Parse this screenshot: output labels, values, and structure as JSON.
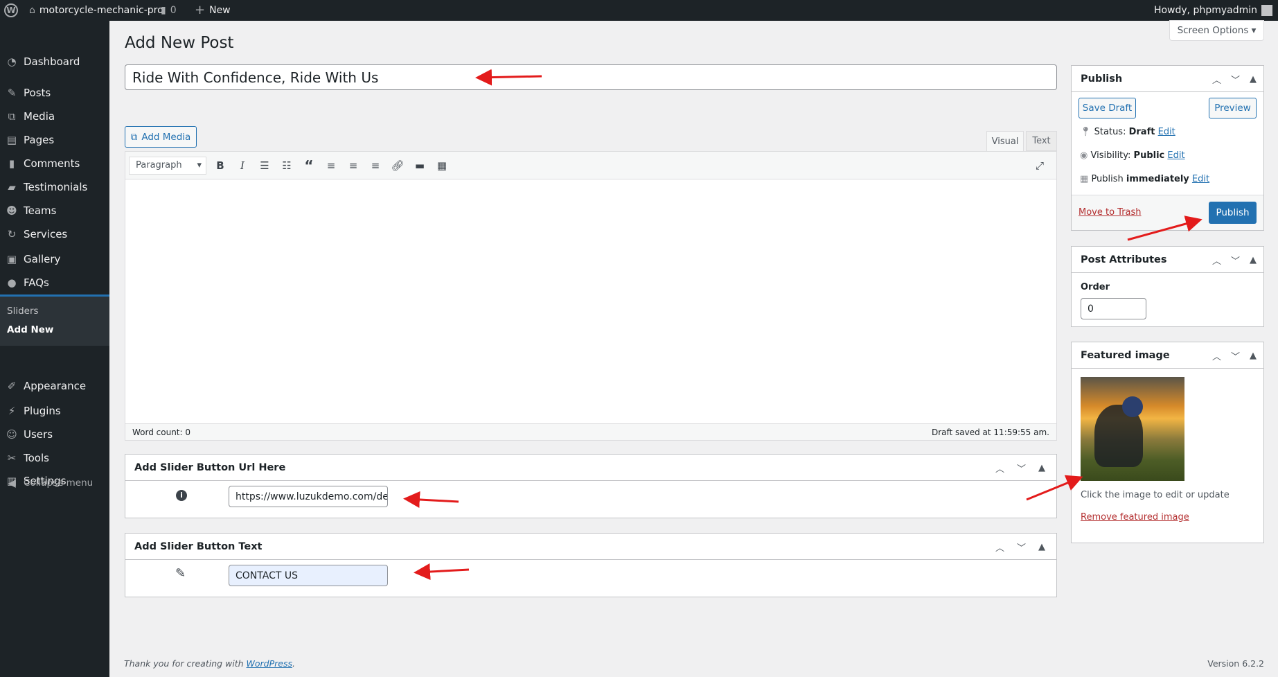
{
  "admin_bar": {
    "site_name": "motorcycle-mechanic-pro",
    "comments_count": "0",
    "new_label": "New",
    "greeting": "Howdy, phpmyadmin"
  },
  "sidebar": {
    "items": [
      {
        "label": "Dashboard",
        "icon": "dashboard-icon"
      },
      {
        "label": "Posts",
        "icon": "pin-icon"
      },
      {
        "label": "Media",
        "icon": "media-icon"
      },
      {
        "label": "Pages",
        "icon": "pages-icon"
      },
      {
        "label": "Comments",
        "icon": "comment-icon"
      },
      {
        "label": "Testimonials",
        "icon": "testimonial-icon"
      },
      {
        "label": "Teams",
        "icon": "groups-icon"
      },
      {
        "label": "Services",
        "icon": "refresh-icon"
      },
      {
        "label": "Gallery",
        "icon": "gallery-icon"
      },
      {
        "label": "FAQs",
        "icon": "faq-icon"
      },
      {
        "label": "Sliders",
        "icon": "slides-icon"
      },
      {
        "label": "Appearance",
        "icon": "brush-icon"
      },
      {
        "label": "Plugins",
        "icon": "plugin-icon"
      },
      {
        "label": "Users",
        "icon": "users-icon"
      },
      {
        "label": "Tools",
        "icon": "wrench-icon"
      },
      {
        "label": "Settings",
        "icon": "settings-icon"
      }
    ],
    "submenu": [
      "Sliders",
      "Add New"
    ],
    "collapse": "Collapse menu"
  },
  "screen_options": "Screen Options",
  "page_title": "Add New Post",
  "post_title": "Ride With Confidence, Ride With Us",
  "editor": {
    "add_media": "Add Media",
    "tabs": [
      "Visual",
      "Text"
    ],
    "format": "Paragraph",
    "word_count": "Word count: 0",
    "draft_saved": "Draft saved at 11:59:55 am."
  },
  "slider_url": {
    "title": "Add Slider Button Url Here",
    "value": "https://www.luzukdemo.com/den"
  },
  "slider_text": {
    "title": "Add Slider Button Text",
    "value": "CONTACT US"
  },
  "publish": {
    "title": "Publish",
    "save_draft": "Save Draft",
    "preview": "Preview",
    "status_label": "Status:",
    "status": "Draft",
    "visibility_label": "Visibility:",
    "visibility": "Public",
    "publish_label": "Publish",
    "publish_when": "immediately",
    "edit": "Edit",
    "trash": "Move to Trash",
    "publish_button": "Publish"
  },
  "attributes": {
    "title": "Post Attributes",
    "order_label": "Order",
    "order_value": "0"
  },
  "featured": {
    "title": "Featured image",
    "hint": "Click the image to edit or update",
    "remove": "Remove featured image"
  },
  "footer": {
    "thanks": "Thank you for creating with ",
    "link": "WordPress",
    "period": ".",
    "version": "Version 6.2.2"
  },
  "colors": {
    "accent": "#2271b1",
    "adminbar": "#1d2327",
    "annotation": "#e31b1b"
  }
}
